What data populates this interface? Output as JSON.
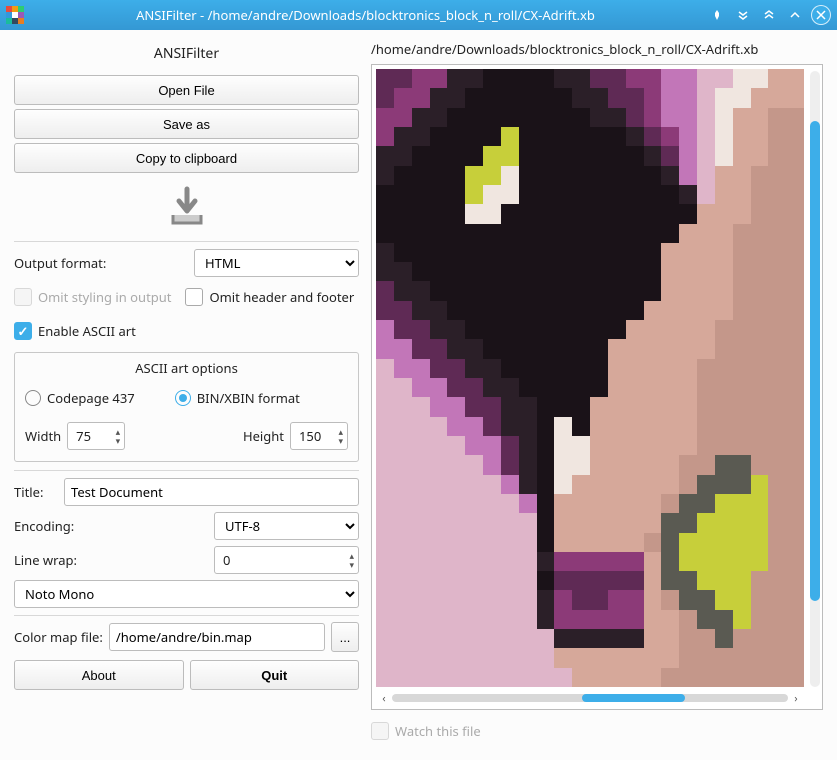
{
  "window": {
    "title": "ANSIFilter - /home/andre/Downloads/blocktronics_block_n_roll/CX-Adrift.xb"
  },
  "app": {
    "name": "ANSIFilter"
  },
  "buttons": {
    "open_file": "Open File",
    "save_as": "Save as",
    "copy_clipboard": "Copy to clipboard",
    "about": "About",
    "quit": "Quit",
    "browse": "..."
  },
  "labels": {
    "output_format": "Output format:",
    "omit_styling": "Omit styling in output",
    "omit_header": "Omit header and footer",
    "enable_ascii": "Enable ASCII art",
    "ascii_options": "ASCII art options",
    "codepage": "Codepage 437",
    "binxbin": "BIN/XBIN format",
    "width": "Width",
    "height": "Height",
    "title": "Title:",
    "encoding": "Encoding:",
    "line_wrap": "Line wrap:",
    "colormap": "Color map file:",
    "watch": "Watch this file"
  },
  "values": {
    "output_format": "HTML",
    "width": "75",
    "height": "150",
    "title_value": "Test Document",
    "encoding": "UTF-8",
    "line_wrap": "0",
    "font": "Noto Mono",
    "colormap_path": "/home/andre/bin.map"
  },
  "preview": {
    "path": "/home/andre/Downloads/blocktronics_block_n_roll/CX-Adrift.xb"
  },
  "icons": {
    "pin": "📌",
    "down2": "⇊",
    "up2": "⇈",
    "up": "∧",
    "close": "✕"
  }
}
